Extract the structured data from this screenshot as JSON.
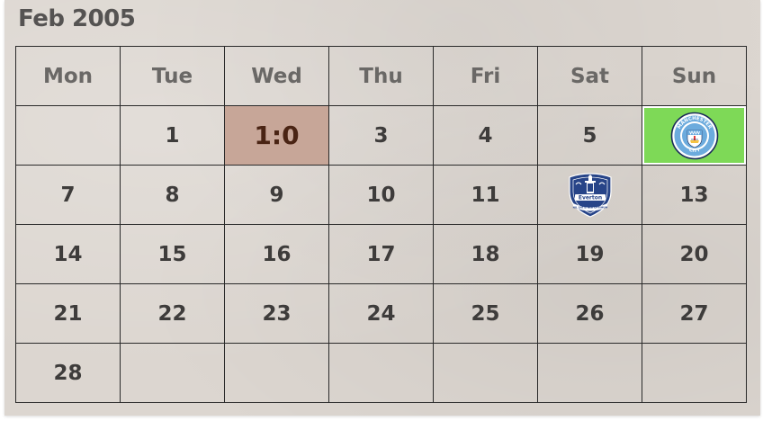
{
  "calendar": {
    "title": "Feb 2005",
    "weekdays": [
      "Mon",
      "Tue",
      "Wed",
      "Thu",
      "Fri",
      "Sat",
      "Sun"
    ],
    "weeks": [
      [
        "",
        "1",
        "1:0",
        "3",
        "4",
        "5",
        ""
      ],
      [
        "7",
        "8",
        "9",
        "10",
        "11",
        "",
        "13"
      ],
      [
        "14",
        "15",
        "16",
        "17",
        "18",
        "19",
        "20"
      ],
      [
        "21",
        "22",
        "23",
        "24",
        "25",
        "26",
        "27"
      ],
      [
        "28",
        "",
        "",
        "",
        "",
        "",
        ""
      ]
    ],
    "crests": {
      "man_city": {
        "top_text": "MANCHESTER",
        "bottom_text": "CITY"
      },
      "everton": {
        "name": "Everton",
        "motto": "NIL SATIS NISI OPTIMUM"
      }
    },
    "colors": {
      "score_highlight": "#c7a698",
      "match_highlight": "#7ed957",
      "man_city_blue": "#6cabdd",
      "everton_blue": "#274488"
    }
  }
}
